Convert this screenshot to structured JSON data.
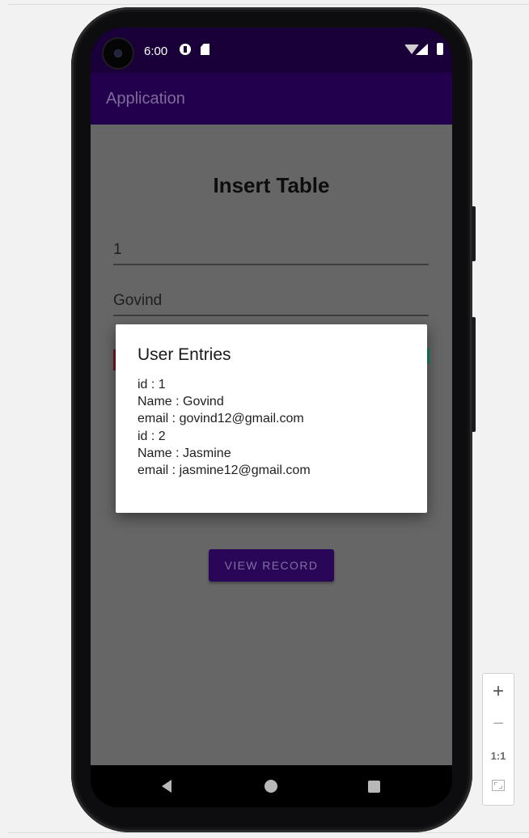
{
  "status_bar": {
    "time": "6:00",
    "icons": [
      "sync-icon",
      "sd-card-icon",
      "wifi-icon",
      "signal-icon",
      "battery-icon"
    ]
  },
  "app_bar": {
    "title": "Application"
  },
  "form": {
    "heading": "Insert Table",
    "id_value": "1",
    "name_value": "Govind",
    "view_button_label": "VIEW RECORD"
  },
  "dialog": {
    "title": "User Entries",
    "lines": [
      "id : 1",
      "Name : Govind",
      "email : govind12@gmail.com",
      "id : 2",
      "Name : Jasmine",
      "email : jasmine12@gmail.com"
    ]
  },
  "nav_bar": {
    "icons": [
      "back-icon",
      "home-icon",
      "recents-icon"
    ]
  },
  "zoom_controls": {
    "zoom_in": "+",
    "zoom_out": "−",
    "actual_size": "1:1"
  },
  "colors": {
    "status_bar": "#1a0038",
    "app_bar": "#23004d",
    "content_scrim": "#666666",
    "button": "#2a0659"
  }
}
